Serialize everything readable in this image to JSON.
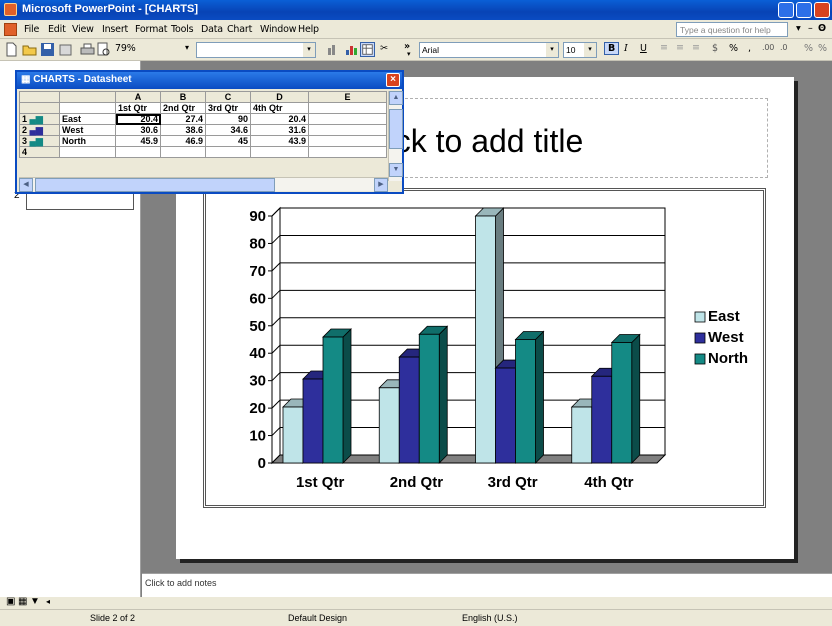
{
  "window": {
    "title": "Microsoft PowerPoint - [CHARTS]"
  },
  "menu": [
    "File",
    "Edit",
    "View",
    "Insert",
    "Format",
    "Tools",
    "Data",
    "Chart",
    "Window",
    "Help"
  ],
  "help_placeholder": "Type a question for help",
  "toolbar": {
    "zoom": "79%",
    "font": "Arial",
    "size": "10"
  },
  "datasheet": {
    "title": "CHARTS - Datasheet",
    "col_letters": [
      "A",
      "B",
      "C",
      "D",
      "E"
    ],
    "col_headers": [
      "1st Qtr",
      "2nd Qtr",
      "3rd Qtr",
      "4th Qtr"
    ],
    "rows": [
      {
        "num": "1",
        "name": "East",
        "values": [
          "20.4",
          "27.4",
          "90",
          "20.4"
        ]
      },
      {
        "num": "2",
        "name": "West",
        "values": [
          "30.6",
          "38.6",
          "34.6",
          "31.6"
        ]
      },
      {
        "num": "3",
        "name": "North",
        "values": [
          "45.9",
          "46.9",
          "45",
          "43.9"
        ]
      },
      {
        "num": "4",
        "name": "",
        "values": [
          "",
          "",
          "",
          ""
        ]
      }
    ]
  },
  "slide": {
    "title_placeholder": "ck to add title",
    "thumb_number": "2"
  },
  "notes_placeholder": "Click to add notes",
  "status": {
    "slide": "Slide 2 of 2",
    "design": "Default Design",
    "language": "English (U.S.)"
  },
  "colors": {
    "east": "#bfe4e8",
    "west": "#2e2f9c",
    "north": "#148a85"
  },
  "chart_data": {
    "type": "bar",
    "categories": [
      "1st Qtr",
      "2nd Qtr",
      "3rd Qtr",
      "4th Qtr"
    ],
    "series": [
      {
        "name": "East",
        "values": [
          20.4,
          27.4,
          90,
          20.4
        ]
      },
      {
        "name": "West",
        "values": [
          30.6,
          38.6,
          34.6,
          31.6
        ]
      },
      {
        "name": "North",
        "values": [
          45.9,
          46.9,
          45,
          43.9
        ]
      }
    ],
    "ylim": [
      0,
      90
    ],
    "yticks": [
      0,
      10,
      20,
      30,
      40,
      50,
      60,
      70,
      80,
      90
    ],
    "grid": true,
    "legend": "right",
    "style": "3d-clustered-column"
  }
}
